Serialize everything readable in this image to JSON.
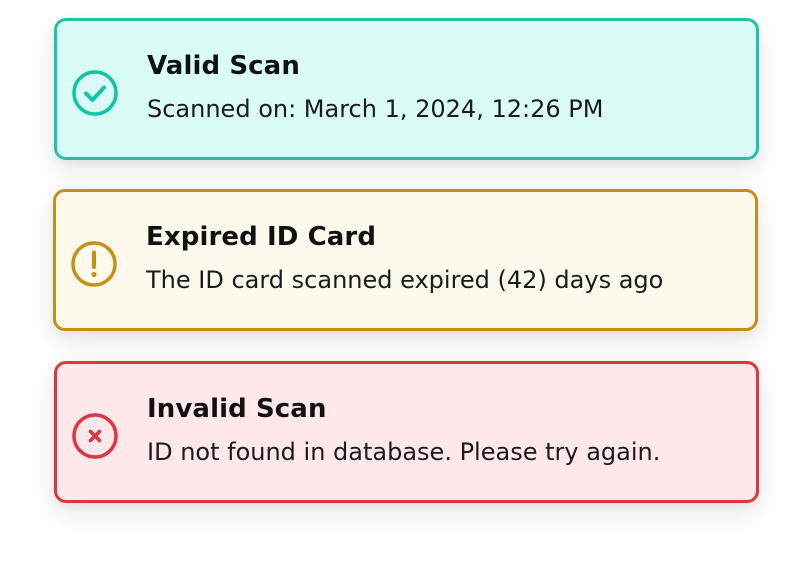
{
  "alerts": [
    {
      "type": "success",
      "icon": "check-circle-icon",
      "title": "Valid Scan",
      "message": "Scanned on: March 1, 2024, 12:26 PM",
      "colors": {
        "background": "#d9fdf6",
        "border": "#1fc4a6",
        "icon": "#13c3a1"
      }
    },
    {
      "type": "warning",
      "icon": "exclamation-circle-icon",
      "title": "Expired ID Card",
      "message": "The ID card scanned expired (42) days ago",
      "colors": {
        "background": "#fef9ed",
        "border": "#c48e17",
        "icon": "#c49219"
      }
    },
    {
      "type": "error",
      "icon": "x-circle-icon",
      "title": "Invalid Scan",
      "message": "ID not found in database. Please try again.",
      "colors": {
        "background": "#ffe8ea",
        "border": "#dc3640",
        "icon": "#dc3640"
      }
    }
  ]
}
